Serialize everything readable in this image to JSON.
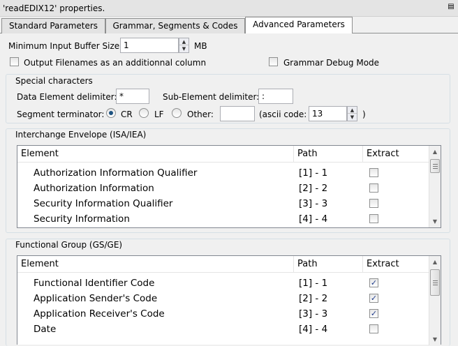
{
  "window": {
    "title": "'readEDIX12' properties."
  },
  "tabs": [
    {
      "label": "Standard Parameters"
    },
    {
      "label": "Grammar, Segments & Codes"
    },
    {
      "label": "Advanced Parameters"
    }
  ],
  "buffer": {
    "label": "Minimum Input Buffer Size:",
    "value": "1",
    "unit": "MB"
  },
  "options": {
    "output_filenames": {
      "label": "Output Filenames as an additionnal column",
      "checked": false
    },
    "grammar_debug": {
      "label": "Grammar Debug Mode",
      "checked": false
    }
  },
  "special": {
    "title": "Special characters",
    "data_element_label": "Data Element delimiter:",
    "data_element_value": "*",
    "sub_element_label": "Sub-Element delimiter:",
    "sub_element_value": ":",
    "segment_label": "Segment terminator:",
    "cr_label": "CR",
    "lf_label": "LF",
    "other_label": "Other:",
    "other_value": "",
    "ascii_label": "(ascii code:",
    "ascii_value": "13",
    "ascii_close": ")"
  },
  "interchange": {
    "title": "Interchange Envelope (ISA/IEA)",
    "columns": [
      "Element",
      "Path",
      "Extract"
    ],
    "rows": [
      {
        "element": "Authorization Information Qualifier",
        "path": "[1] - 1",
        "extract": false
      },
      {
        "element": "Authorization Information",
        "path": "[2] - 2",
        "extract": false
      },
      {
        "element": "Security Information Qualifier",
        "path": "[3] - 3",
        "extract": false
      },
      {
        "element": "Security Information",
        "path": "[4] - 4",
        "extract": false
      }
    ]
  },
  "functional": {
    "title": "Functional Group (GS/GE)",
    "columns": [
      "Element",
      "Path",
      "Extract"
    ],
    "rows": [
      {
        "element": "Functional Identifier Code",
        "path": "[1] - 1",
        "extract": true
      },
      {
        "element": "Application Sender's Code",
        "path": "[2] - 2",
        "extract": true
      },
      {
        "element": "Application Receiver's Code",
        "path": "[3] - 3",
        "extract": true
      },
      {
        "element": "Date",
        "path": "[4] - 4",
        "extract": false
      }
    ]
  }
}
